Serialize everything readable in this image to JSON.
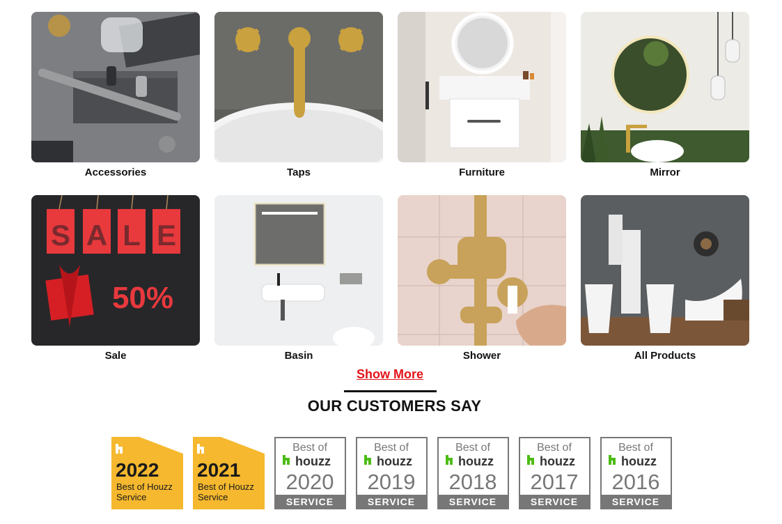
{
  "categories": [
    {
      "label": "Accessories",
      "icon": "accessories-photo"
    },
    {
      "label": "Taps",
      "icon": "taps-photo"
    },
    {
      "label": "Furniture",
      "icon": "furniture-photo"
    },
    {
      "label": "Mirror",
      "icon": "mirror-photo"
    },
    {
      "label": "Sale",
      "icon": "sale-photo",
      "tags": [
        "S",
        "A",
        "L",
        "E"
      ],
      "discount": "50%"
    },
    {
      "label": "Basin",
      "icon": "basin-photo"
    },
    {
      "label": "Shower",
      "icon": "shower-photo"
    },
    {
      "label": "All Products",
      "icon": "all-products-photo"
    }
  ],
  "show_more": {
    "label": "Show More",
    "color": "#e2141a"
  },
  "testimonials": {
    "title": "OUR CUSTOMERS SAY"
  },
  "awards": [
    {
      "style": "yellow",
      "year": "2022",
      "line1": "Best of Houzz",
      "line2": "Service",
      "color": "#f5b82e"
    },
    {
      "style": "yellow",
      "year": "2021",
      "line1": "Best of Houzz",
      "line2": "Service",
      "color": "#f5b82e"
    },
    {
      "style": "boxed",
      "top": "Best of",
      "brand": "houzz",
      "year": "2020",
      "bottom": "SERVICE"
    },
    {
      "style": "boxed",
      "top": "Best of",
      "brand": "houzz",
      "year": "2019",
      "bottom": "SERVICE"
    },
    {
      "style": "boxed",
      "top": "Best of",
      "brand": "houzz",
      "year": "2018",
      "bottom": "SERVICE"
    },
    {
      "style": "boxed",
      "top": "Best of",
      "brand": "houzz",
      "year": "2017",
      "bottom": "SERVICE"
    },
    {
      "style": "boxed",
      "top": "Best of",
      "brand": "houzz",
      "year": "2016",
      "bottom": "SERVICE"
    }
  ],
  "brand_green": "#4dbc15"
}
